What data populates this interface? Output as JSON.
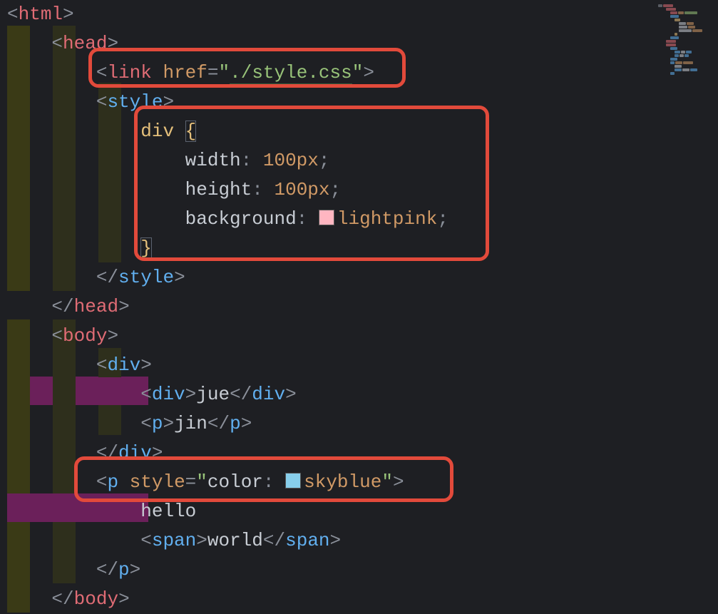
{
  "code": {
    "l1": {
      "lt": "<",
      "tag": "html",
      "gt": ">"
    },
    "l2": {
      "lt": "<",
      "tag": "head",
      "gt": ">"
    },
    "l3": {
      "lt": "<",
      "tag": "link",
      "attr": "href",
      "eq": "=",
      "q1": "\"",
      "str": "./style.css",
      "q2": "\"",
      "gt": ">"
    },
    "l4": {
      "lt": "<",
      "tag": "style",
      "gt": ">"
    },
    "l5": {
      "sel": "div",
      "brace": "{"
    },
    "l6": {
      "prop": "width",
      "colon": ":",
      "val": "100px",
      "semi": ";"
    },
    "l7": {
      "prop": "height",
      "colon": ":",
      "val": "100px",
      "semi": ";"
    },
    "l8": {
      "prop": "background",
      "colon": ":",
      "swatch": "#ffb6c1",
      "color": "lightpink",
      "semi": ";"
    },
    "l9": {
      "brace": "}"
    },
    "l10": {
      "lt": "</",
      "tag": "style",
      "gt": ">"
    },
    "l11": {
      "lt": "</",
      "tag": "head",
      "gt": ">"
    },
    "l12": {
      "lt": "<",
      "tag": "body",
      "gt": ">"
    },
    "l13": {
      "lt": "<",
      "tag": "div",
      "gt": ">"
    },
    "l14": {
      "lt1": "<",
      "tag1": "div",
      "gt1": ">",
      "text": "jue",
      "lt2": "</",
      "tag2": "div",
      "gt2": ">"
    },
    "l15": {
      "lt1": "<",
      "tag1": "p",
      "gt1": ">",
      "text": "jin",
      "lt2": "</",
      "tag2": "p",
      "gt2": ">"
    },
    "l16": {
      "lt": "</",
      "tag": "div",
      "gt": ">"
    },
    "l17": {
      "lt": "<",
      "tag": "p",
      "attr": "style",
      "eq": "=",
      "q1": "\"",
      "prop": "color",
      "colon": ":",
      "swatch": "#87ceeb",
      "color": "skyblue",
      "q2": "\"",
      "gt": ">"
    },
    "l18": {
      "text": "hello"
    },
    "l19": {
      "lt1": "<",
      "tag1": "span",
      "gt1": ">",
      "text": "world",
      "lt2": "</",
      "tag2": "span",
      "gt2": ">"
    },
    "l20": {
      "lt": "</",
      "tag": "p",
      "gt": ">"
    },
    "l21": {
      "lt": "</",
      "tag": "body",
      "gt": ">"
    }
  },
  "colors": {
    "lightpink": "#ffb6c1",
    "skyblue": "#87ceeb",
    "highlight_border": "#e24a3b"
  }
}
